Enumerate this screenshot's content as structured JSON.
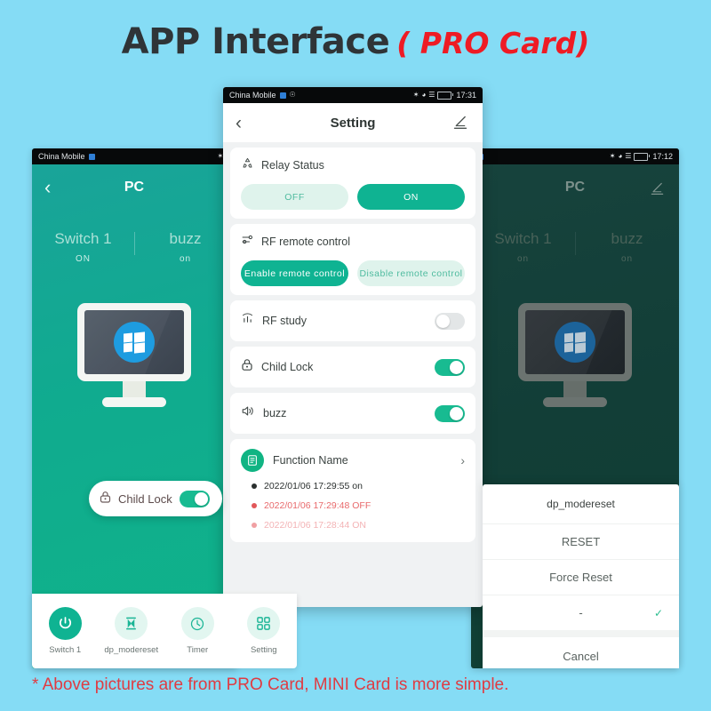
{
  "page": {
    "background_color": "#85dcf5",
    "title_main": "APP Interface",
    "title_sub": "( PRO Card)",
    "title_main_color": "#2f3437",
    "title_sub_color": "#ee1b24",
    "footnote": "* Above pictures are from PRO Card, MINI Card is more simple.",
    "footnote_color": "#e03b42",
    "accent_color": "#0fb392"
  },
  "left_phone": {
    "statusbar": {
      "carrier": "China Mobile",
      "time": ""
    },
    "header": {
      "back_icon": "‹",
      "title": "PC"
    },
    "switches": [
      {
        "name": "Switch 1",
        "state": "ON"
      },
      {
        "name": "buzz",
        "state": "on"
      }
    ],
    "child_lock_card": {
      "label": "Child Lock",
      "toggle": "on"
    },
    "bottom_nav": [
      {
        "label": "Switch 1",
        "icon": "power-icon",
        "active": true
      },
      {
        "label": "dp_modereset",
        "icon": "hourglass-icon",
        "active": false
      },
      {
        "label": "Timer",
        "icon": "clock-icon",
        "active": false
      },
      {
        "label": "Setting",
        "icon": "grid-icon",
        "active": false
      }
    ]
  },
  "center_phone": {
    "statusbar": {
      "carrier": "China Mobile",
      "time": "17:31"
    },
    "header": {
      "back_icon": "‹",
      "title": "Setting",
      "edit_icon": "pencil-icon"
    },
    "relay_status": {
      "label": "Relay Status",
      "icon": "recycle-icon",
      "buttons": [
        {
          "label": "OFF",
          "active": false
        },
        {
          "label": "ON",
          "active": true
        }
      ]
    },
    "rf_remote": {
      "label": "RF remote control",
      "icon": "sliders-icon",
      "buttons": [
        {
          "label": "Enable remote control",
          "active": true
        },
        {
          "label": "Disable remote control",
          "active": false
        }
      ]
    },
    "toggle_rows": [
      {
        "label": "RF study",
        "icon": "chart-icon",
        "state": "off"
      },
      {
        "label": "Child Lock",
        "icon": "lock-icon",
        "state": "on"
      },
      {
        "label": "buzz",
        "icon": "speaker-icon",
        "state": "on"
      }
    ],
    "function_name": {
      "label": "Function Name",
      "icon": "document-icon",
      "chevron": "›",
      "logs": [
        {
          "text": "2022/01/06 17:29:55 on",
          "color": "#2a2f2e",
          "bullet": "#2a2f2e"
        },
        {
          "text": "2022/01/06 17:29:48 OFF",
          "color": "#e8696b",
          "bullet": "#e1575a"
        },
        {
          "text": "2022/01/06 17:28:44 ON",
          "color": "#f3b3b5",
          "bullet": "#f0a0a3"
        }
      ]
    }
  },
  "right_phone": {
    "statusbar": {
      "carrier": "",
      "time": "17:12"
    },
    "header": {
      "title": "PC",
      "edit_icon": "pencil-icon"
    },
    "switches": [
      {
        "name": "Switch 1",
        "state": "on"
      },
      {
        "name": "buzz",
        "state": "on"
      }
    ],
    "bottom_sheet": {
      "title": "dp_modereset",
      "options": [
        {
          "label": "RESET",
          "selected": false
        },
        {
          "label": "Force Reset",
          "selected": false
        },
        {
          "label": "-",
          "selected": true
        }
      ],
      "cancel_label": "Cancel"
    }
  }
}
